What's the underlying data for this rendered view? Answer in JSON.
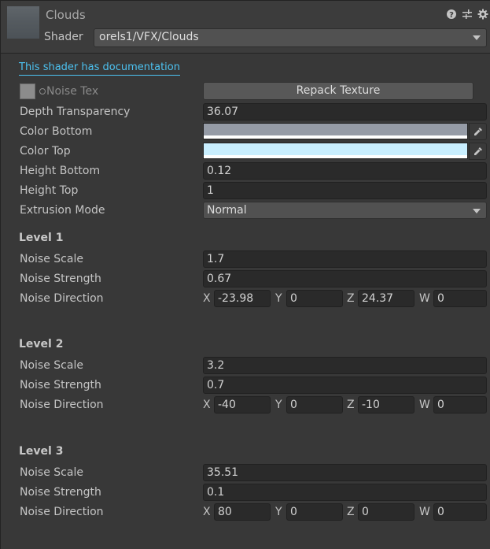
{
  "header": {
    "material_name": "Clouds",
    "shader_label": "Shader",
    "shader_value": "orels1/VFX/Clouds",
    "icons": [
      "help-icon",
      "preset-sliders-icon",
      "gear-icon"
    ]
  },
  "doc_link": "This shader has documentation",
  "properties": {
    "noise_tex": {
      "label": "Noise Tex",
      "button": "Repack Texture"
    },
    "depth_transparency": {
      "label": "Depth Transparency",
      "value": "36.07"
    },
    "color_bottom": {
      "label": "Color Bottom",
      "color": "#959ba6"
    },
    "color_top": {
      "label": "Color Top",
      "color": "#c9efff"
    },
    "height_bottom": {
      "label": "Height Bottom",
      "value": "0.12"
    },
    "height_top": {
      "label": "Height Top",
      "value": "1"
    },
    "extrusion_mode": {
      "label": "Extrusion Mode",
      "value": "Normal"
    }
  },
  "vector_labels": {
    "x": "X",
    "y": "Y",
    "z": "Z",
    "w": "W"
  },
  "levels": [
    {
      "title": "Level 1",
      "scale_label": "Noise Scale",
      "scale": "1.7",
      "strength_label": "Noise Strength",
      "strength": "0.67",
      "direction_label": "Noise Direction",
      "direction": {
        "x": "-23.98",
        "y": "0",
        "z": "24.37",
        "w": "0"
      }
    },
    {
      "title": "Level 2",
      "scale_label": "Noise Scale",
      "scale": "3.2",
      "strength_label": "Noise Strength",
      "strength": "0.7",
      "direction_label": "Noise Direction",
      "direction": {
        "x": "-40",
        "y": "0",
        "z": "-10",
        "w": "0"
      }
    },
    {
      "title": "Level 3",
      "scale_label": "Noise Scale",
      "scale": "35.51",
      "strength_label": "Noise Strength",
      "strength": "0.1",
      "direction_label": "Noise Direction",
      "direction": {
        "x": "80",
        "y": "0",
        "z": "0",
        "w": "0"
      }
    }
  ]
}
